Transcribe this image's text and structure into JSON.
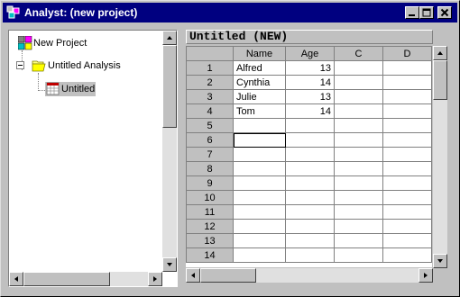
{
  "window": {
    "title": "Analyst: (new project)",
    "buttons": [
      "minimize",
      "maximize",
      "close"
    ]
  },
  "tree": {
    "nodes": [
      {
        "label": "New Project",
        "icon": "project-icon"
      },
      {
        "label": "Untitled Analysis",
        "icon": "folder-open-icon",
        "expander": "−"
      },
      {
        "label": "Untitled",
        "icon": "table-icon",
        "selected": true
      }
    ]
  },
  "grid": {
    "title": "Untitled (NEW)",
    "columns": [
      "Name",
      "Age",
      "C",
      "D"
    ],
    "row_numbers": [
      "1",
      "2",
      "3",
      "4",
      "5",
      "6",
      "7",
      "8",
      "9",
      "10",
      "11",
      "12",
      "13",
      "14"
    ],
    "rows": [
      {
        "name": "Alfred",
        "age": "13"
      },
      {
        "name": "Cynthia",
        "age": "14"
      },
      {
        "name": "Julie",
        "age": "13"
      },
      {
        "name": "Tom",
        "age": "14"
      }
    ]
  },
  "colors": {
    "titlebar": "#000080",
    "face": "#c0c0c0",
    "selection": "#c0c0c0"
  }
}
